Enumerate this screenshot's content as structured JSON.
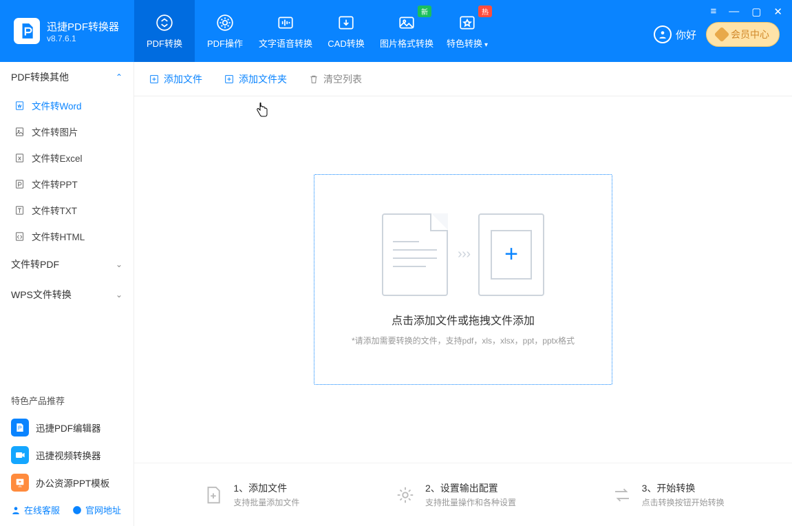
{
  "brand": {
    "title": "迅捷PDF转换器",
    "version": "v8.7.6.1"
  },
  "nav": [
    {
      "label": "PDF转换",
      "icon": "convert"
    },
    {
      "label": "PDF操作",
      "icon": "gear"
    },
    {
      "label": "文字语音转换",
      "icon": "audio"
    },
    {
      "label": "CAD转换",
      "icon": "download"
    },
    {
      "label": "图片格式转换",
      "icon": "image",
      "badge": "新",
      "badgeClass": "green"
    },
    {
      "label": "特色转换",
      "icon": "star",
      "badge": "热",
      "badgeClass": "red",
      "dropdown": true
    }
  ],
  "user": {
    "greeting": "你好"
  },
  "vip": {
    "label": "会员中心"
  },
  "sidebar": {
    "groups": [
      {
        "label": "PDF转换其他",
        "open": true,
        "items": [
          {
            "label": "文件转Word",
            "active": true
          },
          {
            "label": "文件转图片"
          },
          {
            "label": "文件转Excel"
          },
          {
            "label": "文件转PPT"
          },
          {
            "label": "文件转TXT"
          },
          {
            "label": "文件转HTML"
          }
        ]
      },
      {
        "label": "文件转PDF",
        "open": false
      },
      {
        "label": "WPS文件转换",
        "open": false
      }
    ],
    "promoTitle": "特色产品推荐",
    "promos": [
      {
        "label": "迅捷PDF编辑器",
        "cls": "blue"
      },
      {
        "label": "迅捷视频转换器",
        "cls": "cyan"
      },
      {
        "label": "办公资源PPT模板",
        "cls": "orange"
      }
    ],
    "footer": {
      "support": "在线客服",
      "site": "官网地址"
    }
  },
  "toolbar": {
    "addFile": "添加文件",
    "addFolder": "添加文件夹",
    "clear": "清空列表"
  },
  "drop": {
    "title": "点击添加文件或拖拽文件添加",
    "sub": "*请添加需要转换的文件，支持pdf，xls，xlsx，ppt，pptx格式"
  },
  "steps": [
    {
      "t": "1、添加文件",
      "s": "支持批量添加文件"
    },
    {
      "t": "2、设置输出配置",
      "s": "支持批量操作和各种设置"
    },
    {
      "t": "3、开始转换",
      "s": "点击转换按钮开始转换"
    }
  ]
}
